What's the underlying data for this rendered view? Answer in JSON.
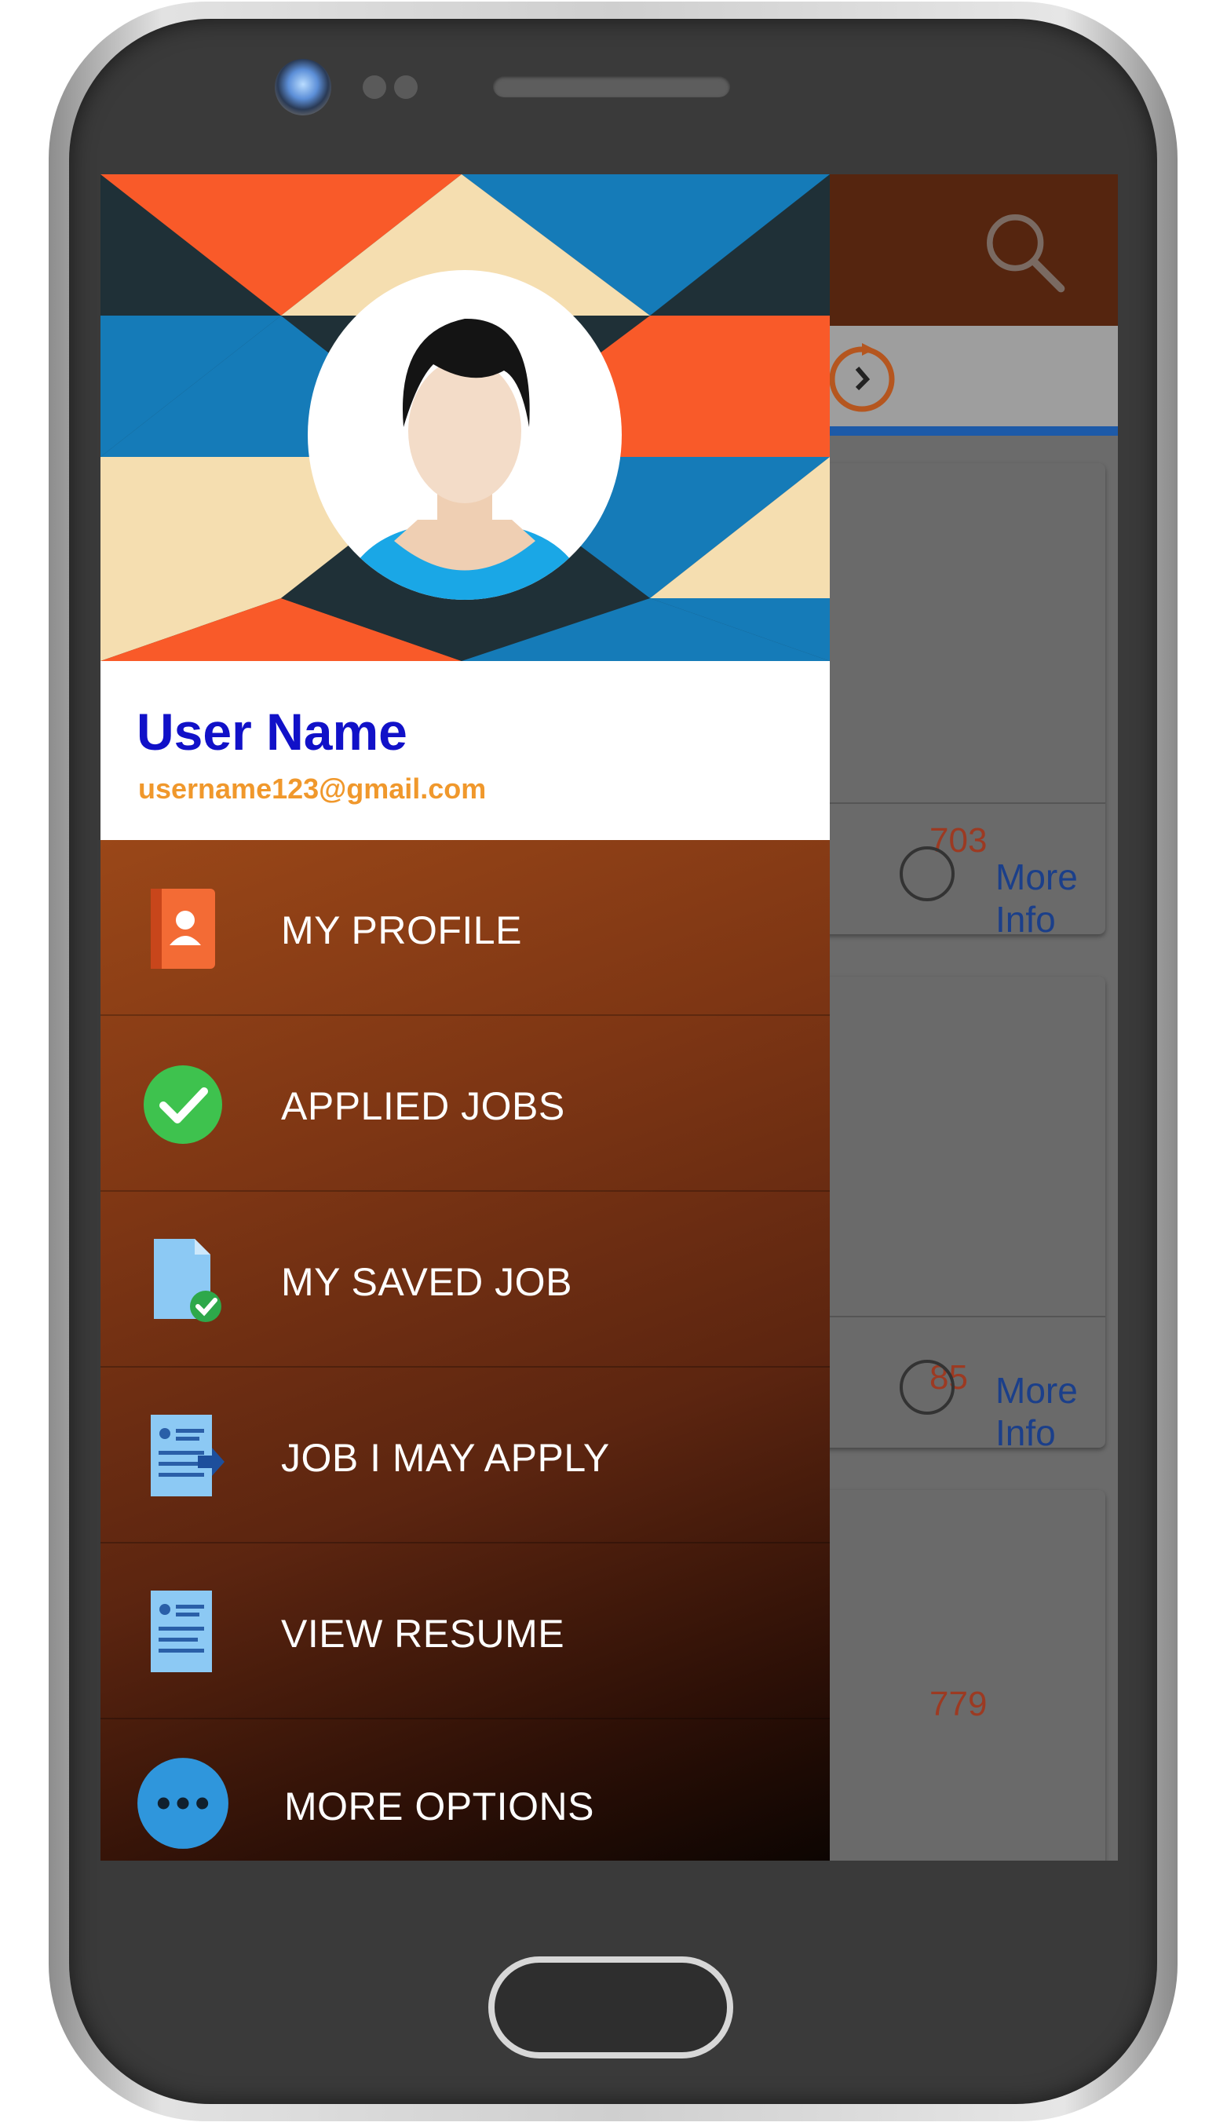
{
  "user": {
    "name": "User Name",
    "email": "username123@gmail.com"
  },
  "menu": {
    "items": [
      {
        "label": "MY PROFILE",
        "icon": "contact-book-icon"
      },
      {
        "label": "APPLIED JOBS",
        "icon": "check-circle-icon"
      },
      {
        "label": "MY SAVED JOB",
        "icon": "saved-document-icon"
      },
      {
        "label": "JOB I MAY APPLY",
        "icon": "document-arrow-icon"
      },
      {
        "label": "VIEW RESUME",
        "icon": "resume-icon"
      },
      {
        "label": "MORE OPTIONS",
        "icon": "more-dots-icon"
      }
    ]
  },
  "background": {
    "cards": [
      {
        "number": "703",
        "action": "More Info"
      },
      {
        "number": "85",
        "action": "More Info"
      },
      {
        "number": "779"
      }
    ]
  },
  "colors": {
    "header": "#55250f",
    "tab_underline": "#1d5aa8",
    "user_name": "#1111c8",
    "user_email": "#f0982c",
    "banner_orange": "#f95a29",
    "banner_cream": "#f5deb0",
    "banner_blue": "#157bb8",
    "banner_dark": "#1f3037"
  }
}
